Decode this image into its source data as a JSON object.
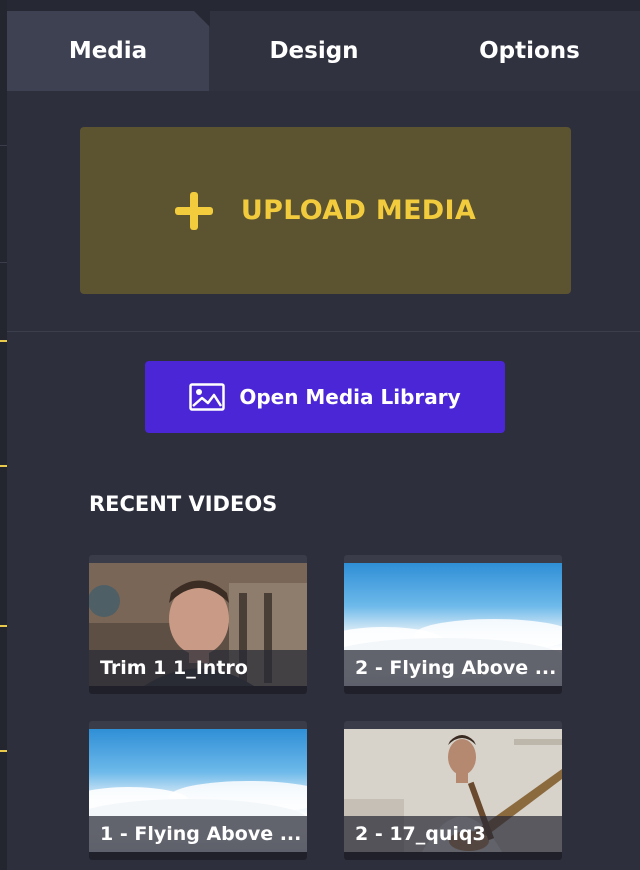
{
  "tabs": [
    {
      "label": "Media",
      "active": true
    },
    {
      "label": "Design",
      "active": false
    },
    {
      "label": "Options",
      "active": false
    }
  ],
  "upload": {
    "label": "UPLOAD MEDIA",
    "icon": "plus-icon"
  },
  "library": {
    "label": "Open Media Library",
    "icon": "image-icon"
  },
  "recent": {
    "title": "RECENT VIDEOS",
    "items": [
      {
        "label": "Trim 1 1_Intro"
      },
      {
        "label": "2 - Flying Above ..."
      },
      {
        "label": "1 - Flying Above ..."
      },
      {
        "label": "2 - 17_quiq3"
      }
    ]
  },
  "colors": {
    "accent_yellow": "#f2cc3c",
    "upload_bg": "#5c5330",
    "library_bg": "#4b26d6",
    "panel_bg": "#2d2f3d"
  }
}
